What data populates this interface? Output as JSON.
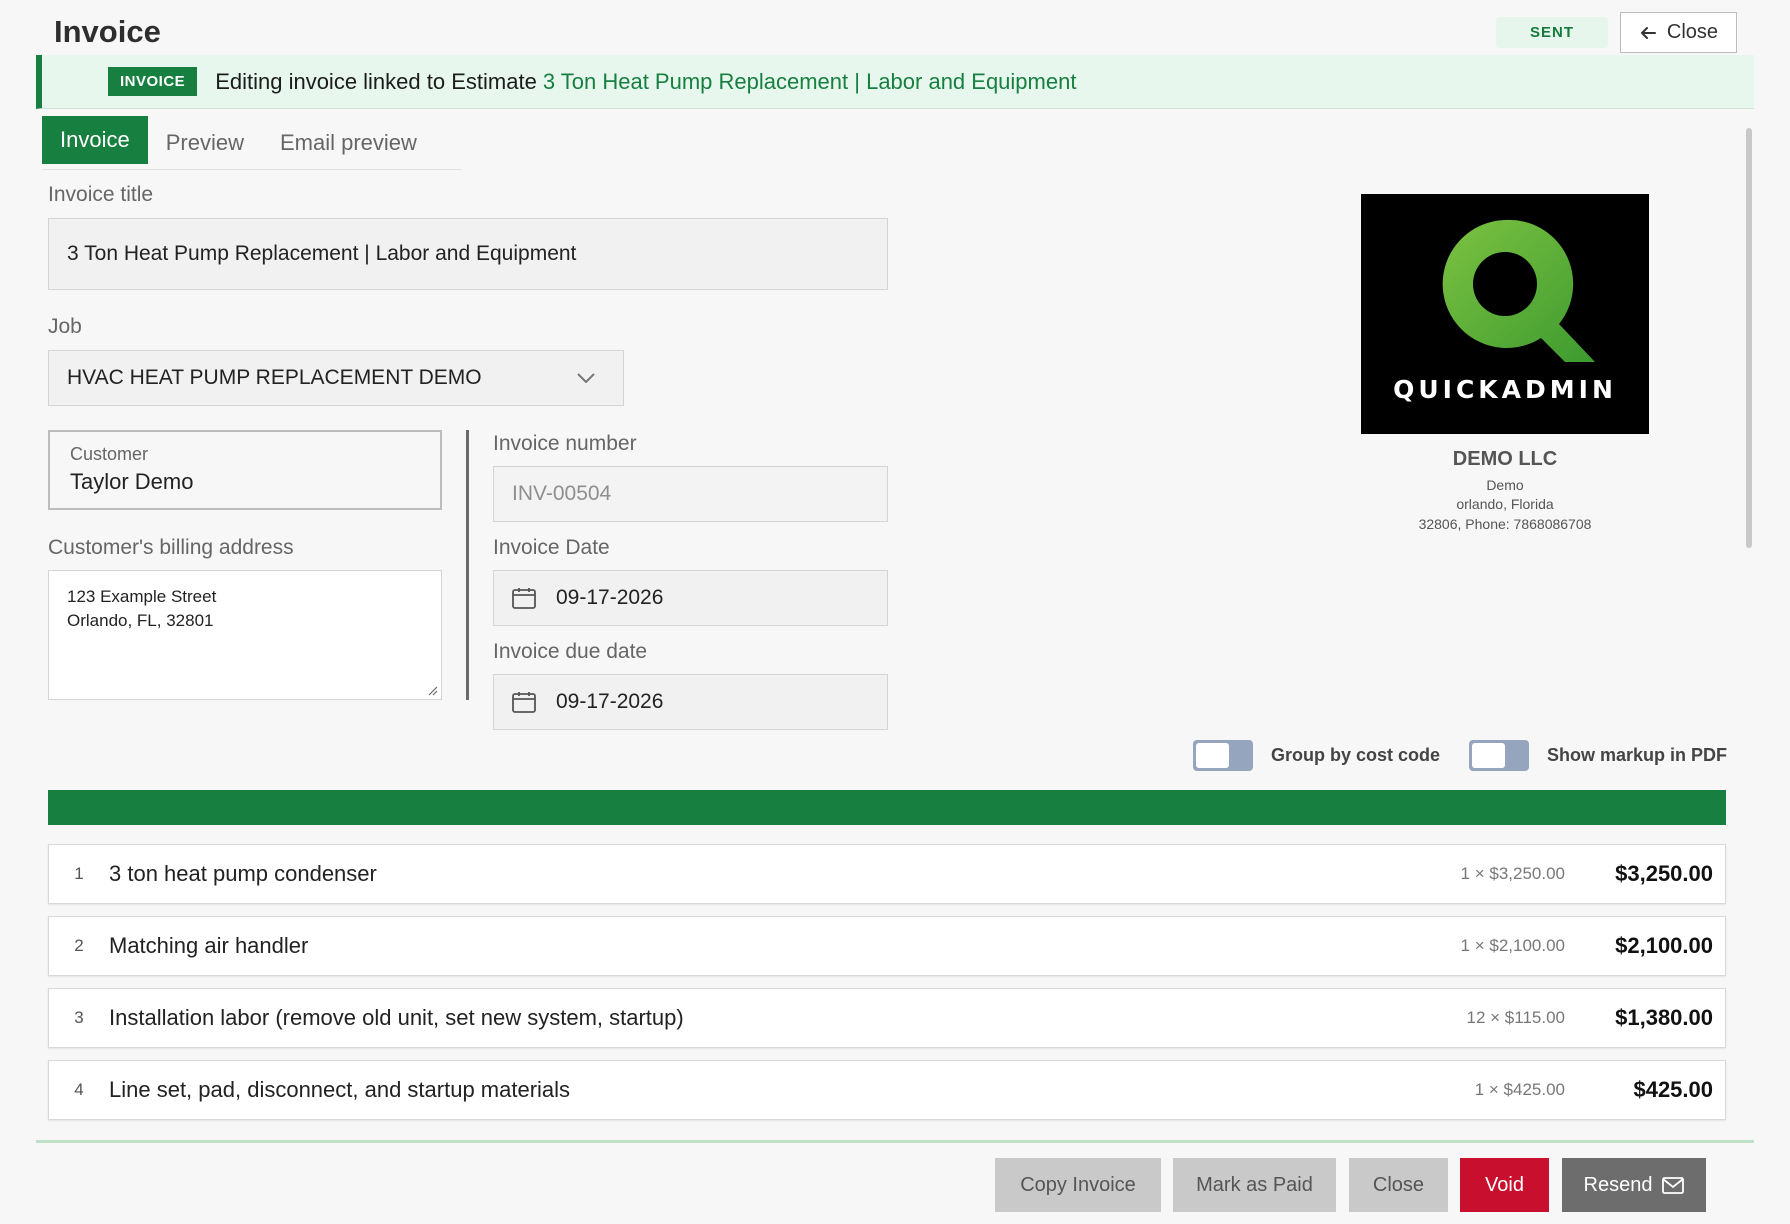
{
  "header": {
    "title": "Invoice",
    "status_badge": "SENT",
    "close_label": "Close"
  },
  "banner": {
    "tag": "INVOICE",
    "text": "Editing invoice linked to Estimate",
    "estimate_link": "3 Ton Heat Pump Replacement | Labor and Equipment"
  },
  "tabs": [
    {
      "label": "Invoice",
      "active": true
    },
    {
      "label": "Preview",
      "active": false
    },
    {
      "label": "Email preview",
      "active": false
    }
  ],
  "form": {
    "invoice_title_label": "Invoice title",
    "invoice_title_value": "3 Ton Heat Pump Replacement | Labor and Equipment",
    "job_label": "Job",
    "job_value": "HVAC HEAT PUMP REPLACEMENT DEMO",
    "customer_label": "Customer",
    "customer_value": "Taylor Demo",
    "billing_label": "Customer's billing address",
    "billing_line1": "123 Example Street",
    "billing_line2": "Orlando, FL, 32801",
    "invoice_number_label": "Invoice number",
    "invoice_number_value": "INV-00504",
    "invoice_date_label": "Invoice Date",
    "invoice_date_value": "09-17-2026",
    "due_date_label": "Invoice due date",
    "due_date_value": "09-17-2026"
  },
  "company": {
    "logo_text": "QUICKADMIN",
    "name": "DEMO LLC",
    "line1": "Demo",
    "line2": "orlando, Florida",
    "line3": "32806, Phone: 7868086708"
  },
  "toggles": {
    "group_by_cost_code": "Group by cost code",
    "show_markup": "Show markup in PDF"
  },
  "line_items": [
    {
      "num": "1",
      "desc": "3 ton heat pump condenser",
      "qty": "1 × $3,250.00",
      "amount": "$3,250.00"
    },
    {
      "num": "2",
      "desc": "Matching air handler",
      "qty": "1 × $2,100.00",
      "amount": "$2,100.00"
    },
    {
      "num": "3",
      "desc": "Installation labor (remove old unit, set new system, startup)",
      "qty": "12 × $115.00",
      "amount": "$1,380.00"
    },
    {
      "num": "4",
      "desc": "Line set, pad, disconnect, and startup materials",
      "qty": "1 × $425.00",
      "amount": "$425.00"
    }
  ],
  "actions": {
    "copy": "Copy Invoice",
    "mark_paid": "Mark as Paid",
    "close": "Close",
    "void": "Void",
    "resend": "Resend"
  },
  "colors": {
    "brand_green": "#178040",
    "void_red": "#c8102e",
    "logo_green": "#5cb531"
  }
}
